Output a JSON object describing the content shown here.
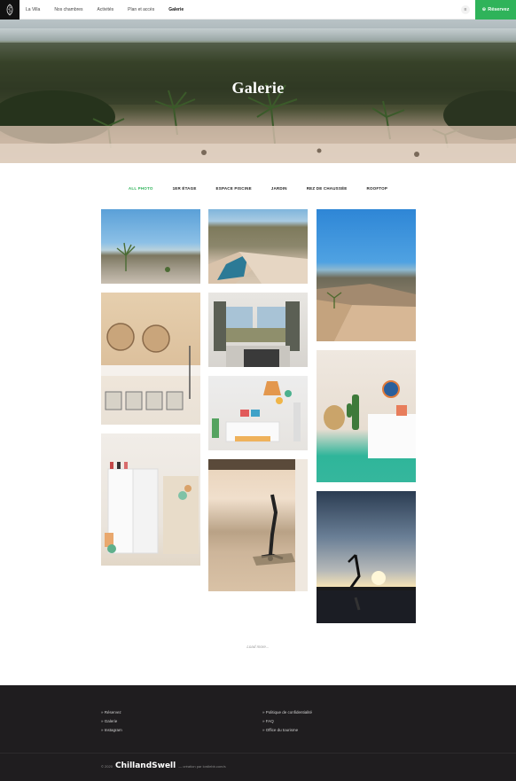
{
  "header": {
    "nav": [
      {
        "label": "La Villa",
        "active": false
      },
      {
        "label": "Nos chambres",
        "active": false
      },
      {
        "label": "Activités",
        "active": false
      },
      {
        "label": "Plan et accès",
        "active": false
      },
      {
        "label": "Galerie",
        "active": true
      }
    ],
    "lang_label": "≡",
    "reserve_label": "Réservez"
  },
  "hero": {
    "title": "Galerie"
  },
  "filters": [
    {
      "label": "ALL PHOTO",
      "active": true
    },
    {
      "label": "1ER ÉTAGE",
      "active": false
    },
    {
      "label": "ESPACE PISCINE",
      "active": false
    },
    {
      "label": "JARDIN",
      "active": false
    },
    {
      "label": "REZ DE CHAUSSÉE",
      "active": false
    },
    {
      "label": "ROOFTOP",
      "active": false
    }
  ],
  "load_more_label": "Load more...",
  "footer": {
    "col1": [
      "» Réservez",
      "» Galerie",
      "» Instagram"
    ],
    "col2": [
      "» Politique de confidentialité",
      "» FAQ",
      "» Office du tourisme"
    ],
    "copyright": "© 2020",
    "brand": "ChillandSwell",
    "credit": "— création par lordlebb.com/s"
  }
}
